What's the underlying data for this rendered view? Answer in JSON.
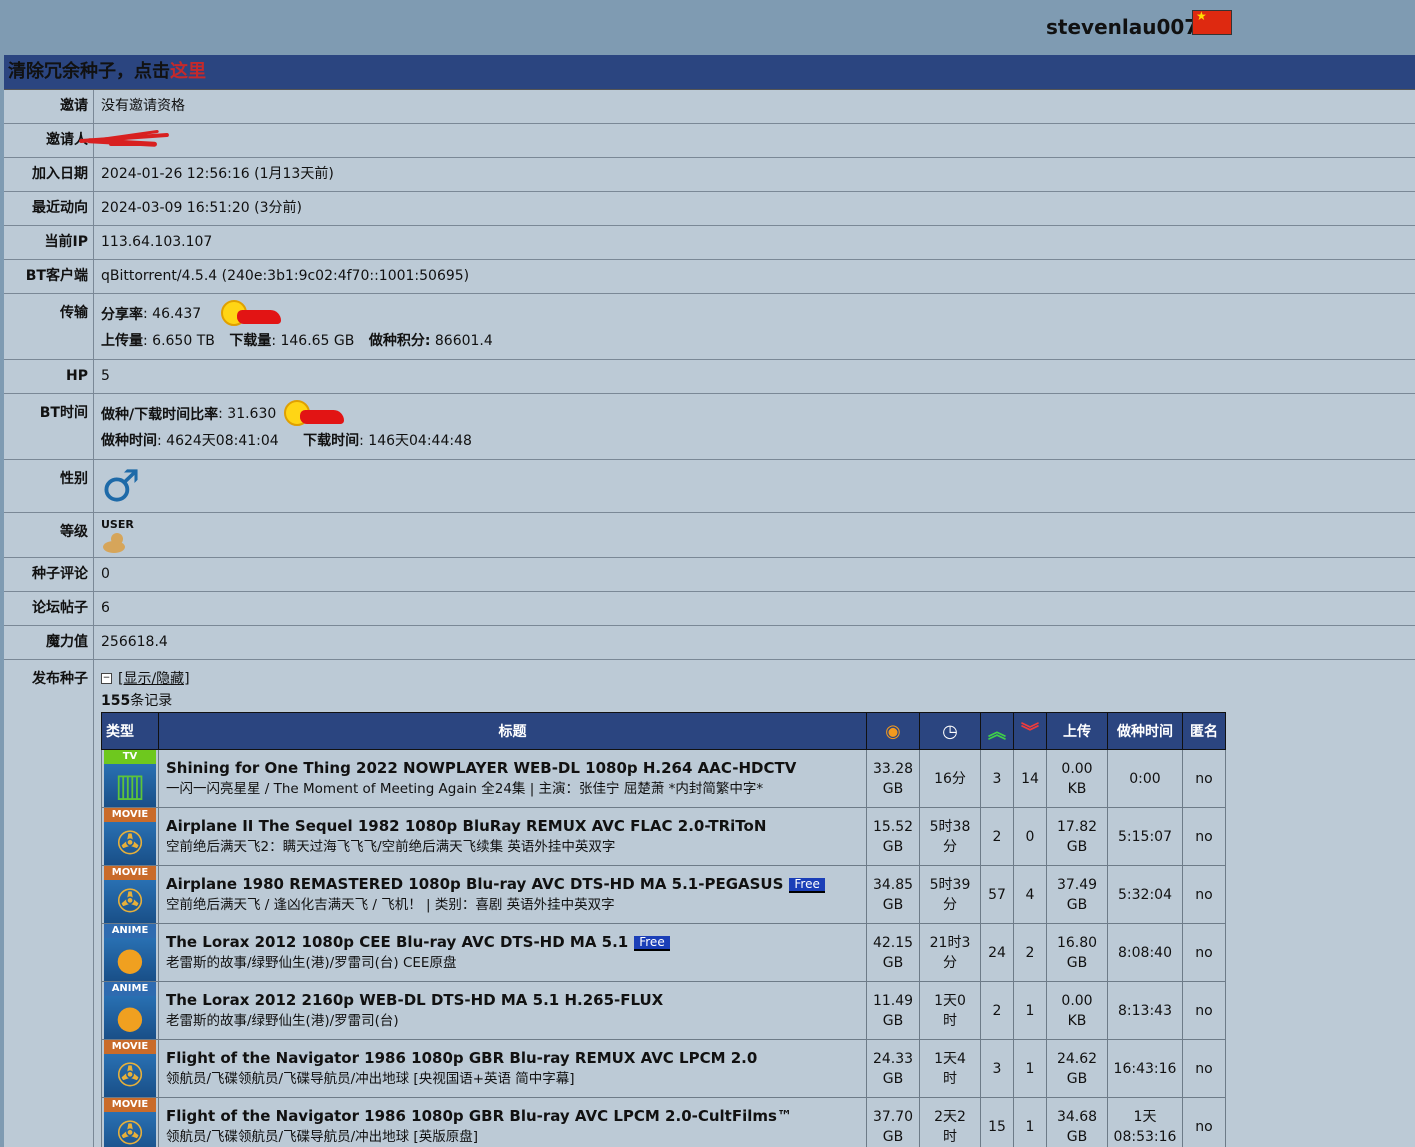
{
  "header": {
    "username": "stevenlau007",
    "flag_icon": "china-flag-icon"
  },
  "notice": {
    "prefix": "清除冗余种子，点击",
    "link": "这里"
  },
  "profile": {
    "invite": {
      "label": "邀请",
      "value": "没有邀请资格"
    },
    "inviter": {
      "label": "邀请人"
    },
    "join_date": {
      "label": "加入日期",
      "value": "2024-01-26 12:56:16 (1月13天前)"
    },
    "last_action": {
      "label": "最近动向",
      "value": "2024-03-09 16:51:20 (3分前)"
    },
    "ip": {
      "label": "当前IP",
      "value": "113.64.103.107"
    },
    "client": {
      "label": "BT客户端",
      "value": "qBittorrent/4.5.4 (240e:3b1:9c02:4f70::1001:50695)"
    },
    "transfer": {
      "label": "传输",
      "ratio_label": "分享率",
      "ratio": ": 46.437",
      "up_label": "上传量",
      "up": ": 6.650 TB",
      "down_label": "下载量",
      "down": ": 146.65 GB",
      "bonus_label": "做种积分:",
      "bonus": " 86601.4"
    },
    "hp": {
      "label": "HP",
      "value": "5"
    },
    "bt_time": {
      "label": "BT时间",
      "ratio_label": "做种/下载时间比率",
      "ratio": ": 31.630",
      "seed_label": "做种时间",
      "seed": ": 4624天08:41:04",
      "leech_label": "下载时间",
      "leech": ": 146天04:44:48"
    },
    "gender": {
      "label": "性别",
      "icon": "male-icon"
    },
    "level": {
      "label": "等级",
      "value": "USER"
    },
    "comments": {
      "label": "种子评论",
      "value": "0"
    },
    "posts": {
      "label": "论坛帖子",
      "value": "6"
    },
    "magic": {
      "label": "魔力值",
      "value": "256618.4"
    },
    "uploads": {
      "label": "发布种子",
      "toggle": "[显示/隐藏]",
      "count": "155",
      "count_suffix": "条记录"
    }
  },
  "torrent_table": {
    "headers": {
      "type": "类型",
      "title": "标题",
      "upload": "上传",
      "seed_time": "做种时间",
      "anon": "匿名"
    },
    "header_icons": [
      "size-icon",
      "time-icon",
      "seeders-icon",
      "leechers-icon"
    ],
    "rows": [
      {
        "cat": "tv",
        "cat_label": "TV",
        "title": "Shining for One Thing 2022 NOWPLAYER WEB-DL 1080p H.264 AAC-HDCTV",
        "free": "",
        "subtitle": "一闪一闪亮星星 / The Moment of Meeting Again 全24集 | 主演：张佳宁 屈楚萧 *内封简繁中字*",
        "size1": "33.28",
        "size2": "GB",
        "time1": "16分",
        "time2": "",
        "seeders": "3",
        "leechers": "14",
        "up1": "0.00",
        "up2": "KB",
        "seed1": "0:00",
        "seed2": "",
        "anon": "no"
      },
      {
        "cat": "movie",
        "cat_label": "MOVIE",
        "title": "Airplane II The Sequel 1982 1080p BluRay REMUX AVC FLAC 2.0-TRiToN",
        "free": "",
        "subtitle": "空前绝后满天飞2：瞒天过海飞飞飞/空前绝后满天飞续集 英语外挂中英双字",
        "size1": "15.52",
        "size2": "GB",
        "time1": "5时38",
        "time2": "分",
        "seeders": "2",
        "leechers": "0",
        "up1": "17.82",
        "up2": "GB",
        "seed1": "5:15:07",
        "seed2": "",
        "anon": "no"
      },
      {
        "cat": "movie",
        "cat_label": "MOVIE",
        "title": "Airplane 1980 REMASTERED 1080p Blu-ray AVC DTS-HD MA 5.1-PEGASUS",
        "free": "Free",
        "subtitle": "空前绝后满天飞 / 逢凶化吉满天飞 / 飞机！ | 类别：喜剧 英语外挂中英双字",
        "size1": "34.85",
        "size2": "GB",
        "time1": "5时39",
        "time2": "分",
        "seeders": "57",
        "leechers": "4",
        "up1": "37.49",
        "up2": "GB",
        "seed1": "5:32:04",
        "seed2": "",
        "anon": "no"
      },
      {
        "cat": "anime",
        "cat_label": "ANIME",
        "title": "The Lorax 2012 1080p CEE Blu-ray AVC DTS-HD MA 5.1",
        "free": "Free",
        "subtitle": "老雷斯的故事/绿野仙生(港)/罗雷司(台) CEE原盘",
        "size1": "42.15",
        "size2": "GB",
        "time1": "21时3",
        "time2": "分",
        "seeders": "24",
        "leechers": "2",
        "up1": "16.80",
        "up2": "GB",
        "seed1": "8:08:40",
        "seed2": "",
        "anon": "no"
      },
      {
        "cat": "anime",
        "cat_label": "ANIME",
        "title": "The Lorax 2012 2160p WEB-DL DTS-HD MA 5.1 H.265-FLUX",
        "free": "",
        "subtitle": "老雷斯的故事/绿野仙生(港)/罗雷司(台)",
        "size1": "11.49",
        "size2": "GB",
        "time1": "1天0",
        "time2": "时",
        "seeders": "2",
        "leechers": "1",
        "up1": "0.00",
        "up2": "KB",
        "seed1": "8:13:43",
        "seed2": "",
        "anon": "no"
      },
      {
        "cat": "movie",
        "cat_label": "MOVIE",
        "title": "Flight of the Navigator 1986 1080p GBR Blu-ray REMUX AVC LPCM 2.0",
        "free": "",
        "subtitle": "领航员/飞碟领航员/飞碟导航员/冲出地球 [央视国语+英语 简中字幕]",
        "size1": "24.33",
        "size2": "GB",
        "time1": "1天4",
        "time2": "时",
        "seeders": "3",
        "leechers": "1",
        "up1": "24.62",
        "up2": "GB",
        "seed1": "16:43:16",
        "seed2": "",
        "anon": "no"
      },
      {
        "cat": "movie",
        "cat_label": "MOVIE",
        "title": "Flight of the Navigator 1986 1080p GBR Blu-ray AVC LPCM 2.0-CultFilms™",
        "free": "",
        "subtitle": "领航员/飞碟领航员/飞碟导航员/冲出地球 [英版原盘]",
        "size1": "37.70",
        "size2": "GB",
        "time1": "2天2",
        "time2": "时",
        "seeders": "15",
        "leechers": "1",
        "up1": "34.68",
        "up2": "GB",
        "seed1": "1天",
        "seed2": "08:53:16",
        "anon": "no"
      }
    ]
  }
}
